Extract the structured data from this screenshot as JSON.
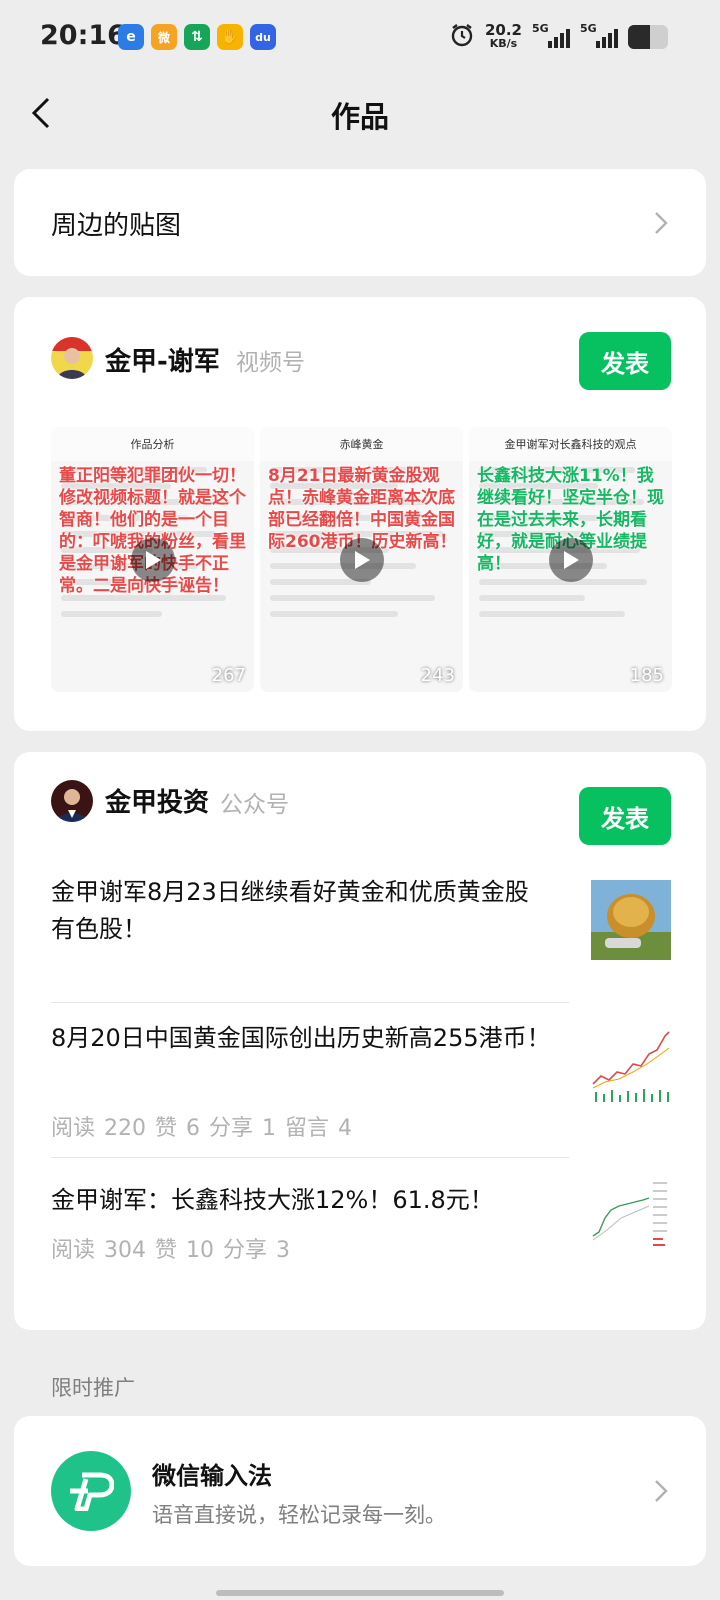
{
  "status_bar": {
    "time": "20:16",
    "app_icons": [
      {
        "name": "browser-app-icon",
        "color": "#2d7be5",
        "glyph": "e"
      },
      {
        "name": "weibo-app-icon",
        "color": "#f4a422",
        "glyph": "微"
      },
      {
        "name": "stock-app-icon",
        "color": "#17a55a",
        "glyph": "⇅"
      },
      {
        "name": "coin-app-icon",
        "color": "#f6b400",
        "glyph": "✋"
      },
      {
        "name": "baidu-app-icon",
        "color": "#3264e3",
        "glyph": "du"
      }
    ],
    "net_speed_value": "20.2",
    "net_speed_unit": "KB/s",
    "signal1_label": "5G",
    "signal2_label": "5G",
    "battery_level": 0.55
  },
  "nav": {
    "title": "作品"
  },
  "stickers": {
    "label": "周边的贴图"
  },
  "channels": {
    "name": "金甲-谢军",
    "type": "视频号",
    "publish_label": "发表",
    "videos": [
      {
        "header": "作品分析",
        "overlay": "董正阳等犯罪团伙一切！修改视频标题！就是这个智商！他们的是一个目的：吓唬我的粉丝，看里是金甲谢军的快手不正常。二是向快手诬告！",
        "overlay_color": "#e84a4a",
        "count": "267"
      },
      {
        "header": "赤峰黄金",
        "overlay": "8月21日最新黄金股观点！赤峰黄金距离本次底部已经翻倍！中国黄金国际260港币！历史新高！",
        "overlay_color": "#e84a4a",
        "count": "243"
      },
      {
        "header": "金甲谢军对长鑫科技的观点",
        "overlay": "长鑫科技大涨11%！我继续看好！坚定半仓！现在是过去未来，长期看好，就是耐心等业绩提高！",
        "overlay_color": "#16b863",
        "count": "185"
      }
    ]
  },
  "official": {
    "name": "金甲投资",
    "type": "公众号",
    "publish_label": "发表",
    "articles": [
      {
        "title": "金甲谢军8月23日继续看好黄金和优质黄金股有色股！",
        "stats": ""
      },
      {
        "title": "8月20日中国黄金国际创出历史新高255港币！",
        "stats": "阅读 220  赞 6  分享 1  留言 4"
      },
      {
        "title": "金甲谢军：长鑫科技大涨12%！61.8元！",
        "stats": "阅读 304  赞 10  分享 3"
      }
    ]
  },
  "promo": {
    "section_label": "限时推广",
    "name": "微信输入法",
    "description": "语音直接说，轻松记录每一刻。"
  },
  "colors": {
    "accent": "#07c160",
    "background": "#ededed",
    "muted": "#b2b2b2"
  }
}
